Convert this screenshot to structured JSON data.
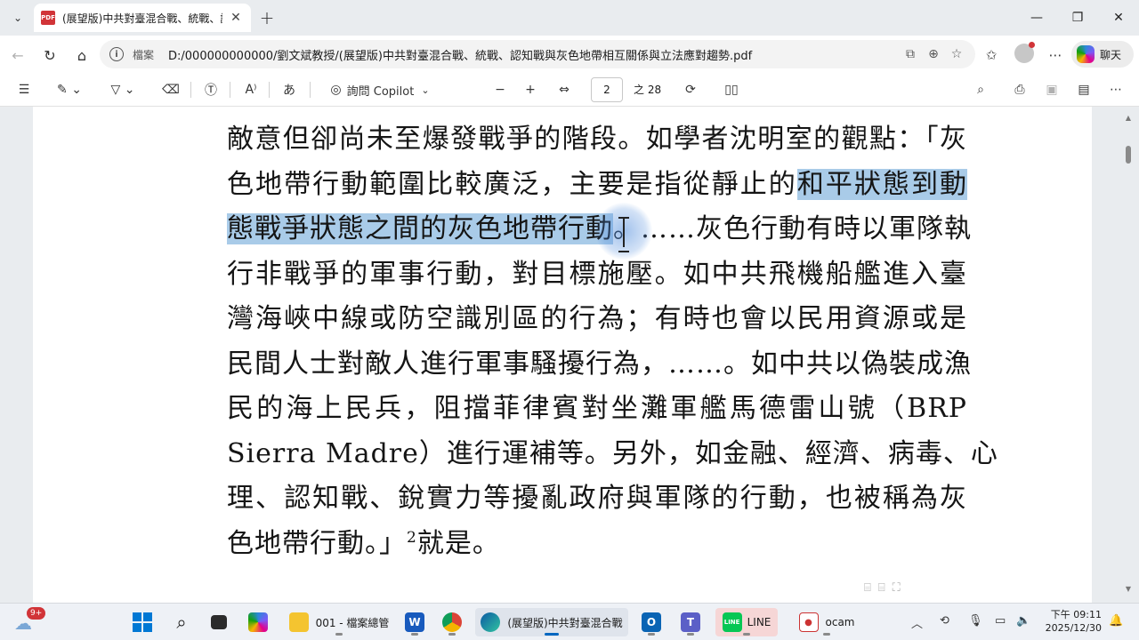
{
  "tab": {
    "title": "(展望版)中共對臺混合戰、統戰、認知戰與灰色地帶相互關係與立法應對趨勢.pdf",
    "icon_text": "PDF"
  },
  "address": {
    "scheme": "檔案",
    "url": "D:/000000000000/劉文斌教授/(展望版)中共對臺混合戰、統戰、認知戰與灰色地帶相互關係與立法應對趨勢.pdf"
  },
  "copilot_button": {
    "label": "聊天"
  },
  "pdf_toolbar": {
    "ask_copilot_label": "詢問 Copilot",
    "current_page": "2",
    "total_pages_label": "之 28"
  },
  "document": {
    "lines": [
      {
        "plain": "敵意但卻尚未至爆發戰爭的階段。如學者沈明室的觀點：「灰",
        "hl": "",
        "tail": ""
      },
      {
        "plain": "色地帶行動範圍比較廣泛，主要是指從靜止的",
        "hl": "和平狀態到動",
        "tail": ""
      },
      {
        "plain": "",
        "hl": "態戰爭狀態之間的灰色地帶行動",
        "tail": "。……灰色行動有時以軍隊執"
      },
      {
        "plain": "行非戰爭的軍事行動，對目標施壓。如中共飛機船艦進入臺",
        "hl": "",
        "tail": ""
      },
      {
        "plain": "灣海峽中線或防空識別區的行為；有時也會以民用資源或是",
        "hl": "",
        "tail": ""
      },
      {
        "plain": "民間人士對敵人進行軍事騷擾行為，……。如中共以偽裝成漁",
        "hl": "",
        "tail": ""
      },
      {
        "plain": "民的海上民兵，阻擋菲律賓對坐灘軍艦馬德雷山號（BRP",
        "hl": "",
        "tail": ""
      },
      {
        "plain": "Sierra Madre）進行運補等。另外，如金融、經濟、病毒、心",
        "hl": "",
        "tail": ""
      },
      {
        "plain": "理、認知戰、銳實力等擾亂政府與軍隊的行動，也被稱為灰",
        "hl": "",
        "tail": ""
      }
    ],
    "last_line_text": "色地帶行動。」",
    "footnote_ref": "2",
    "last_line_tail": "就是。"
  },
  "taskbar": {
    "weather_badge": "9+",
    "explorer_label": "001 - 檔案總管",
    "edge_label": "(展望版)中共對臺混合戰",
    "line_label": "LINE",
    "ocam_label": "ocam",
    "clock_time": "下午 09:11",
    "clock_date": "2025/12/30"
  },
  "colors": {
    "selection_highlight": "#a9cbe8",
    "pdf_red": "#d13438",
    "accent": "#0067c0",
    "line_green": "#06c755"
  }
}
